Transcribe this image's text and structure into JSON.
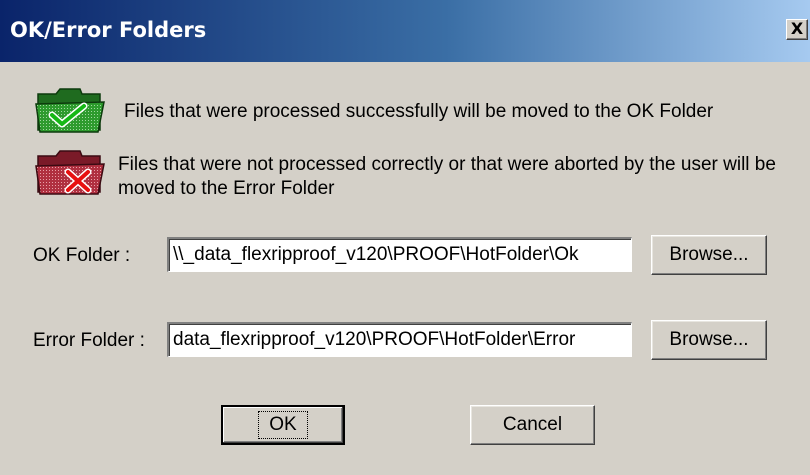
{
  "window": {
    "title": "OK/Error Folders",
    "close_label": "X"
  },
  "info": {
    "ok_icon": "folder-checkmark-icon",
    "ok_text": "Files that were processed successfully will be moved to the OK Folder",
    "error_icon": "folder-error-icon",
    "error_text": "Files that were not processed correctly or that were aborted by the user will be moved to the Error Folder"
  },
  "form": {
    "ok_folder_label": "OK Folder   :",
    "ok_folder_value": "\\\\_data_flexripproof_v120\\PROOF\\HotFolder\\Ok",
    "error_folder_label": "Error Folder :",
    "error_folder_value": "data_flexripproof_v120\\PROOF\\HotFolder\\Error",
    "browse_label": "Browse..."
  },
  "buttons": {
    "ok_label": "OK",
    "cancel_label": "Cancel"
  },
  "colors": {
    "titlebar_start": "#0a246a",
    "titlebar_end": "#a6caf0",
    "dialog_bg": "#d4d0c8",
    "ok_folder_green": "#2e9b2e",
    "error_folder_red": "#b03040"
  }
}
